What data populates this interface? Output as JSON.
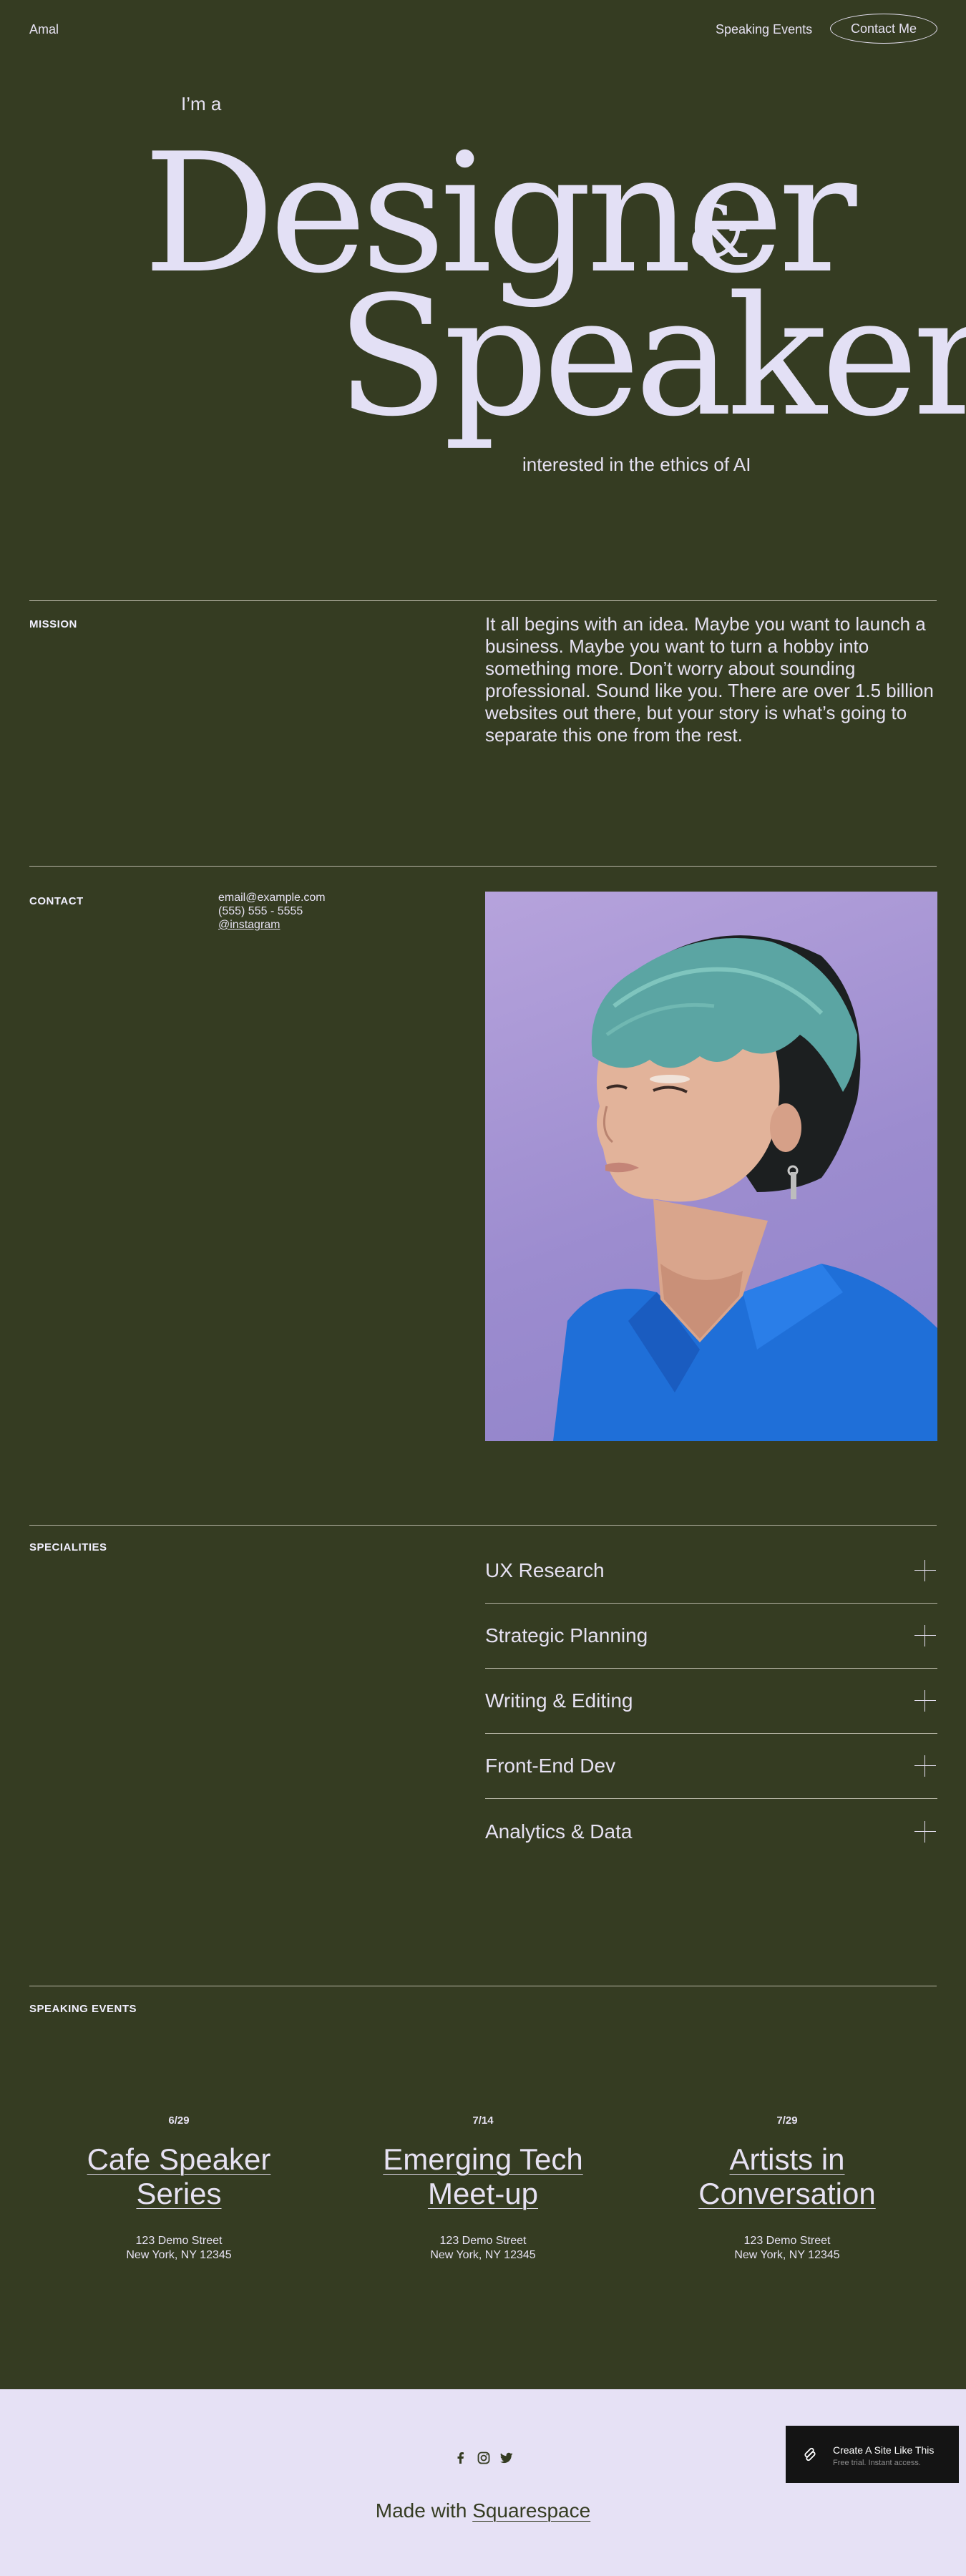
{
  "header": {
    "site_title": "Amal",
    "nav_speaking": "Speaking Events",
    "contact_button": "Contact Me"
  },
  "hero": {
    "pre": "I’m a",
    "word1": "Designer",
    "amp": "&",
    "word2": "Speaker",
    "post": "interested in the ethics of AI"
  },
  "mission": {
    "label": "MISSION",
    "text": "It all begins with an idea. Maybe you want to launch a business. Maybe you want to turn a hobby into something more. Don’t worry about sounding professional. Sound like you. There are over 1.5 billion websites out there, but your story is what’s going to separate this one from the rest."
  },
  "contact": {
    "label": "CONTACT",
    "email": "email@example.com",
    "phone": "(555) 555 - 5555",
    "instagram": "@instagram"
  },
  "specialities": {
    "label": "SPECIALITIES",
    "items": [
      {
        "label": "UX Research"
      },
      {
        "label": "Strategic Planning"
      },
      {
        "label": "Writing & Editing"
      },
      {
        "label": "Front-End Dev"
      },
      {
        "label": "Analytics & Data"
      }
    ]
  },
  "events": {
    "label": "SPEAKING EVENTS",
    "items": [
      {
        "date": "6/29",
        "title_line1": "Cafe Speaker",
        "title_line2": "Series",
        "street": "123 Demo Street",
        "city": "New York, NY 12345"
      },
      {
        "date": "7/14",
        "title_line1": "Emerging Tech",
        "title_line2": "Meet-up",
        "street": "123 Demo Street",
        "city": "New York, NY 12345"
      },
      {
        "date": "7/29",
        "title_line1": "Artists in",
        "title_line2": "Conversation",
        "street": "123 Demo Street",
        "city": "New York, NY 12345"
      }
    ]
  },
  "footer": {
    "made_with": "Made with",
    "squarespace": "Squarespace",
    "social_icons": [
      "facebook-icon",
      "instagram-icon",
      "twitter-icon"
    ]
  },
  "badge": {
    "title": "Create A Site Like This",
    "subtitle": "Free trial. Instant access."
  },
  "colors": {
    "background": "#353c22",
    "text": "#e6e1f2",
    "footer_bg": "#e6e1f5",
    "badge_bg": "#141414"
  }
}
